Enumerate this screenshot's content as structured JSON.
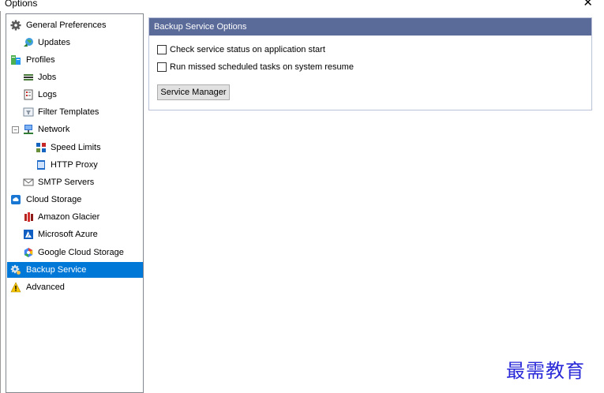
{
  "window": {
    "title": "Options",
    "close_glyph": "✕"
  },
  "tree": {
    "items": [
      {
        "label": "General Preferences",
        "icon": "gear-icon"
      },
      {
        "label": "Updates",
        "icon": "globe-update-icon"
      },
      {
        "label": "Profiles",
        "icon": "profiles-icon"
      },
      {
        "label": "Jobs",
        "icon": "jobs-icon"
      },
      {
        "label": "Logs",
        "icon": "logs-icon"
      },
      {
        "label": "Filter Templates",
        "icon": "filter-icon"
      },
      {
        "label": "Network",
        "icon": "network-icon",
        "expander": "−"
      },
      {
        "label": "Speed Limits",
        "icon": "speed-limits-icon"
      },
      {
        "label": "HTTP Proxy",
        "icon": "http-proxy-icon"
      },
      {
        "label": "SMTP Servers",
        "icon": "mail-icon"
      },
      {
        "label": "Cloud Storage",
        "icon": "cloud-icon"
      },
      {
        "label": "Amazon Glacier",
        "icon": "amazon-glacier-icon"
      },
      {
        "label": "Microsoft Azure",
        "icon": "azure-icon"
      },
      {
        "label": "Google Cloud Storage",
        "icon": "google-cloud-icon"
      },
      {
        "label": "Backup Service",
        "icon": "backup-service-gear-icon",
        "selected": true
      },
      {
        "label": "Advanced",
        "icon": "warning-icon"
      }
    ]
  },
  "panel": {
    "header": "Backup Service Options",
    "check_status_label": "Check service status on application start",
    "run_missed_label": "Run missed scheduled tasks on system resume",
    "service_manager_label": "Service Manager"
  },
  "colors": {
    "selection": "#0078d7",
    "panel_header": "#5a6a99"
  },
  "watermark": "最需教育"
}
